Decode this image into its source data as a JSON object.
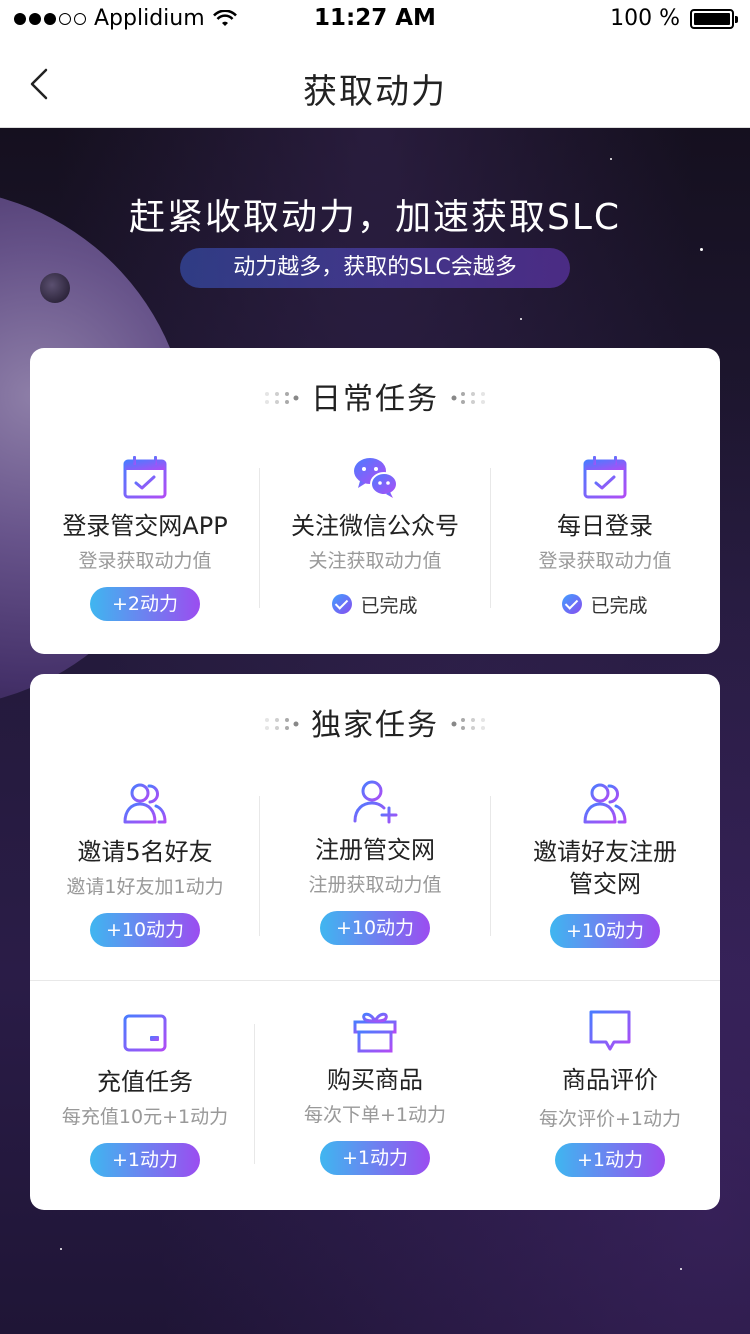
{
  "status_bar": {
    "carrier": "Applidium",
    "time": "11:27 AM",
    "battery": "100 %"
  },
  "nav": {
    "title": "获取动力"
  },
  "hero": {
    "title": "赶紧收取动力，加速获取SLC",
    "subtitle": "动力越多，获取的SLC会越多"
  },
  "daily": {
    "title": "日常任务",
    "tasks": [
      {
        "name": "登录管交网APP",
        "desc": "登录获取动力值",
        "action": "+2动力",
        "icon": "calendar-check-icon"
      },
      {
        "name": "关注微信公众号",
        "desc": "关注获取动力值",
        "action": "已完成",
        "icon": "wechat-icon"
      },
      {
        "name": "每日登录",
        "desc": "登录获取动力值",
        "action": "已完成",
        "icon": "calendar-check-icon"
      }
    ]
  },
  "exclusive": {
    "title": "独家任务",
    "tasks": [
      {
        "name": "邀请5名好友",
        "desc": "邀请1好友加1动力",
        "action": "+10动力",
        "icon": "users-icon"
      },
      {
        "name": "注册管交网",
        "desc": "注册获取动力值",
        "action": "+10动力",
        "icon": "user-add-icon"
      },
      {
        "name": "邀请好友注册管交网",
        "name_line1": "邀请好友注册",
        "name_line2": "管交网",
        "action": "+10动力",
        "icon": "users-icon"
      },
      {
        "name": "充值任务",
        "desc": "每充值10元+1动力",
        "action": "+1动力",
        "icon": "wallet-icon"
      },
      {
        "name": "购买商品",
        "desc": "每次下单+1动力",
        "action": "+1动力",
        "icon": "gift-icon"
      },
      {
        "name": "商品评价",
        "desc": "每次评价+1动力",
        "action": "+1动力",
        "icon": "comment-icon"
      }
    ]
  },
  "colors": {
    "accent_start": "#3fb6f0",
    "accent_end": "#9b4df0",
    "icon_start": "#4a7cff",
    "icon_end": "#b04cf5"
  }
}
